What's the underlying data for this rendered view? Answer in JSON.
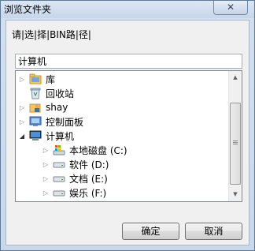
{
  "window": {
    "title": "浏览文件夹",
    "close_label": "✕"
  },
  "prompt": "请|选|择|BIN路|径|",
  "folder_input": {
    "value": "计算机"
  },
  "tree": {
    "items": [
      {
        "label": "库",
        "icon": "library-icon",
        "expander": "▷"
      },
      {
        "label": "回收站",
        "icon": "recycle-bin-icon",
        "expander": ""
      },
      {
        "label": "shay",
        "icon": "user-folder-icon",
        "expander": "▷"
      },
      {
        "label": "控制面板",
        "icon": "control-panel-icon",
        "expander": "▷"
      },
      {
        "label": "计算机",
        "icon": "computer-icon",
        "expander": "◢"
      },
      {
        "label": "本地磁盘 (C:)",
        "icon": "system-drive-icon",
        "expander": "▷"
      },
      {
        "label": "软件 (D:)",
        "icon": "drive-icon",
        "expander": "▷"
      },
      {
        "label": "文档 (E:)",
        "icon": "drive-icon",
        "expander": "▷"
      },
      {
        "label": "娱乐 (F:)",
        "icon": "drive-icon",
        "expander": "▷"
      }
    ]
  },
  "scrollbar": {
    "up_arrow": "▲",
    "down_arrow": "▼"
  },
  "buttons": {
    "ok": "确定",
    "cancel": "取消"
  }
}
